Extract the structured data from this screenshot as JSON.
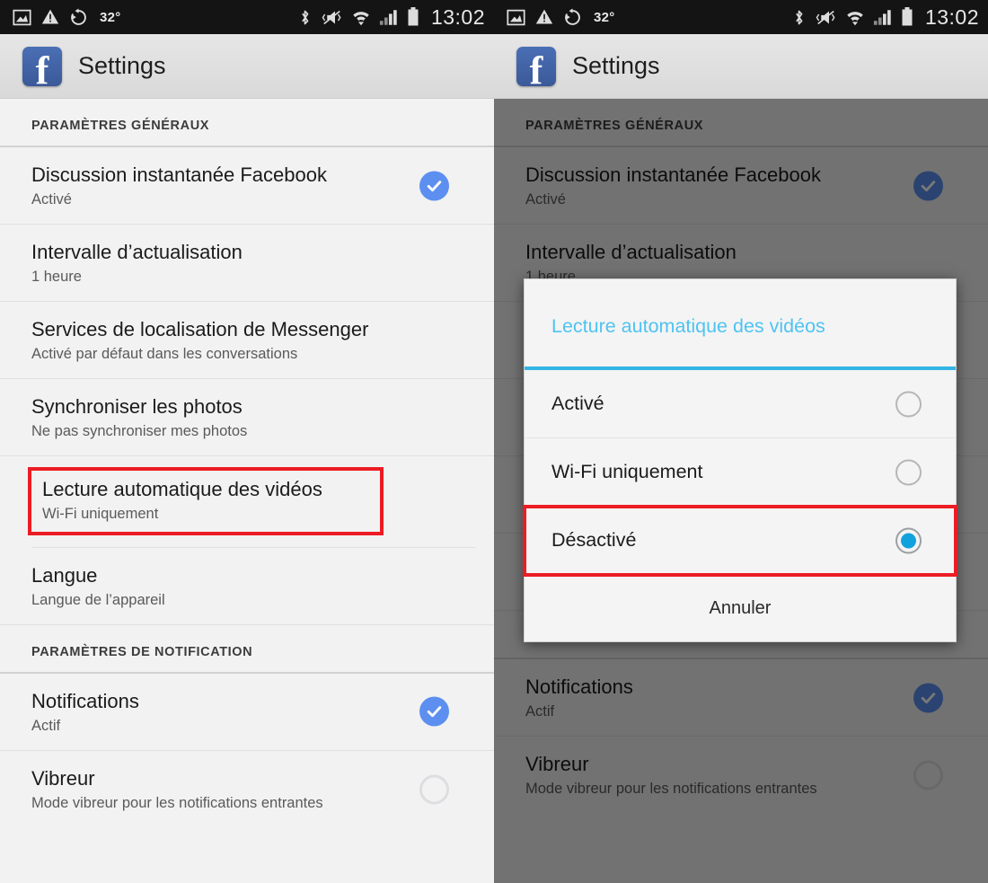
{
  "statusbar": {
    "temperature": "32°",
    "time": "13:02",
    "icons_left": [
      "screenshot-icon",
      "warning-icon",
      "sync-icon"
    ],
    "icons_right": [
      "bluetooth-icon",
      "vibrate-mute-icon",
      "wifi-icon",
      "signal-icon",
      "battery-icon"
    ]
  },
  "appbar": {
    "title": "Settings",
    "logo": "facebook-logo",
    "logo_letter": "f"
  },
  "sections": [
    {
      "header": "PARAMÈTRES GÉNÉRAUX",
      "rows": [
        {
          "title": "Discussion instantanée Facebook",
          "sub": "Activé",
          "widget": "check-on"
        },
        {
          "title": "Intervalle d’actualisation",
          "sub": "1 heure",
          "widget": "none"
        },
        {
          "title": "Services de localisation de Messenger",
          "sub": "Activé par défaut dans les conversations",
          "widget": "none"
        },
        {
          "title": "Synchroniser les photos",
          "sub": "Ne pas synchroniser mes photos",
          "widget": "none"
        },
        {
          "title": "Lecture automatique des vidéos",
          "sub": "Wi-Fi uniquement",
          "widget": "none",
          "highlighted": true
        },
        {
          "title": "Langue",
          "sub": "Langue de l’appareil",
          "widget": "none"
        }
      ]
    },
    {
      "header": "PARAMÈTRES DE NOTIFICATION",
      "rows": [
        {
          "title": "Notifications",
          "sub": "Actif",
          "widget": "check-on"
        },
        {
          "title": "Vibreur",
          "sub": "Mode vibreur pour les notifications entrantes",
          "widget": "check-off"
        }
      ]
    }
  ],
  "dialog": {
    "title": "Lecture automatique des vidéos",
    "options": [
      {
        "label": "Activé",
        "selected": false
      },
      {
        "label": "Wi-Fi uniquement",
        "selected": false
      },
      {
        "label": "Désactivé",
        "selected": true,
        "highlighted": true
      }
    ],
    "cancel_label": "Annuler"
  },
  "colors": {
    "accent_blue": "#35b5e5",
    "title_blue": "#4fc3f2",
    "check_blue": "#5c8ff0",
    "radio_blue": "#11a2de",
    "highlight_red": "#ec1c24",
    "facebook_blue": "#3b5998",
    "statusbar_bg": "#141414"
  }
}
